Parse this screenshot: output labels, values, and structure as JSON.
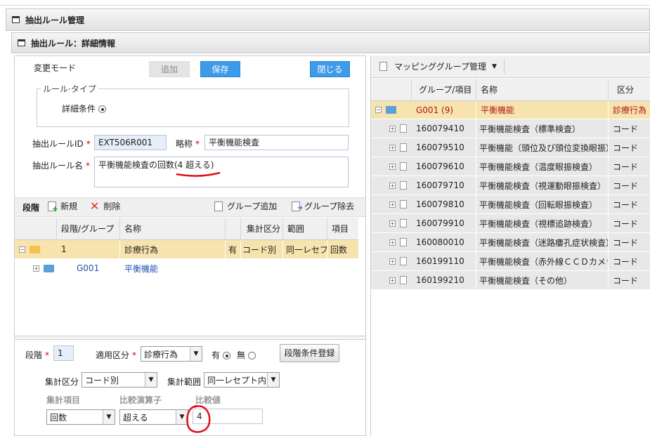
{
  "window": {
    "title": "抽出ルール管理"
  },
  "detail": {
    "title": "抽出ルール：詳細情報",
    "mode_label": "変更モード",
    "add_label": "追加",
    "save_label": "保存",
    "close_label": "閉じる",
    "rule_type_legend": "ルール·タイプ",
    "rule_type_option": "詳細条件",
    "rule_id_label": "抽出ルールID",
    "rule_id_value": "EXT506R001",
    "short_name_label": "略称",
    "short_name_value": "平衡機能検査",
    "rule_name_label": "抽出ルール名",
    "rule_name_value": "平衡機能検査の回数(4 超える)"
  },
  "stage": {
    "toolbar": {
      "title": "段階",
      "new_label": "新規",
      "delete_label": "削除",
      "group_add_label": "グループ追加",
      "group_remove_label": "グループ除去"
    },
    "columns": [
      "段階/グループ",
      "名称",
      "",
      "集計区分",
      "範囲",
      "項目"
    ],
    "rows": [
      {
        "stage": "1",
        "name": "診療行為",
        "flag": "有",
        "agg": "コード別",
        "range": "同一レセプト",
        "item": "回数"
      },
      {
        "stage": "G001",
        "name": "平衡機能"
      }
    ]
  },
  "form": {
    "stage_label": "段階",
    "stage_value": "1",
    "apply_label": "適用区分",
    "apply_value": "診療行為",
    "yes_label": "有",
    "no_label": "無",
    "register_label": "段階条件登録",
    "agg_label": "集計区分",
    "agg_value": "コード別",
    "range_label": "集計範囲",
    "range_value": "同一レセプト内",
    "item_label": "集計項目",
    "op_label": "比較演算子",
    "cmp_label": "比較値",
    "item_value": "回数",
    "op_value": "超える",
    "cmp_value": "4"
  },
  "mapping": {
    "title": "マッピンググループ管理",
    "columns": [
      "グループ/項目",
      "名称",
      "区分"
    ],
    "rows": [
      {
        "code": "G001",
        "count": "(9)",
        "name": "平衡機能",
        "kind": "診療行為"
      },
      {
        "code": "160079410",
        "name": "平衡機能検査（標準検査）",
        "kind": "コード"
      },
      {
        "code": "160079510",
        "name": "平衡機能（頭位及び頭位変換眼振）",
        "kind": "コード"
      },
      {
        "code": "160079610",
        "name": "平衡機能検査（温度眼振検査）",
        "kind": "コード"
      },
      {
        "code": "160079710",
        "name": "平衡機能検査（視運動眼振検査）",
        "kind": "コード"
      },
      {
        "code": "160079810",
        "name": "平衡機能検査（回転眼振検査）",
        "kind": "コード"
      },
      {
        "code": "160079910",
        "name": "平衡機能検査（視標追跡検査）",
        "kind": "コード"
      },
      {
        "code": "160080010",
        "name": "平衡機能検査（迷路瘻孔症状検査）",
        "kind": "コード"
      },
      {
        "code": "160199110",
        "name": "平衡機能検査（赤外線ＣＣＤカメラ等",
        "kind": "コード"
      },
      {
        "code": "160199210",
        "name": "平衡機能検査（その他）",
        "kind": "コード"
      }
    ]
  },
  "colors": {
    "accent": "#3d9be9",
    "selected_row": "#f7e3ad",
    "annotation": "#e0101a"
  }
}
